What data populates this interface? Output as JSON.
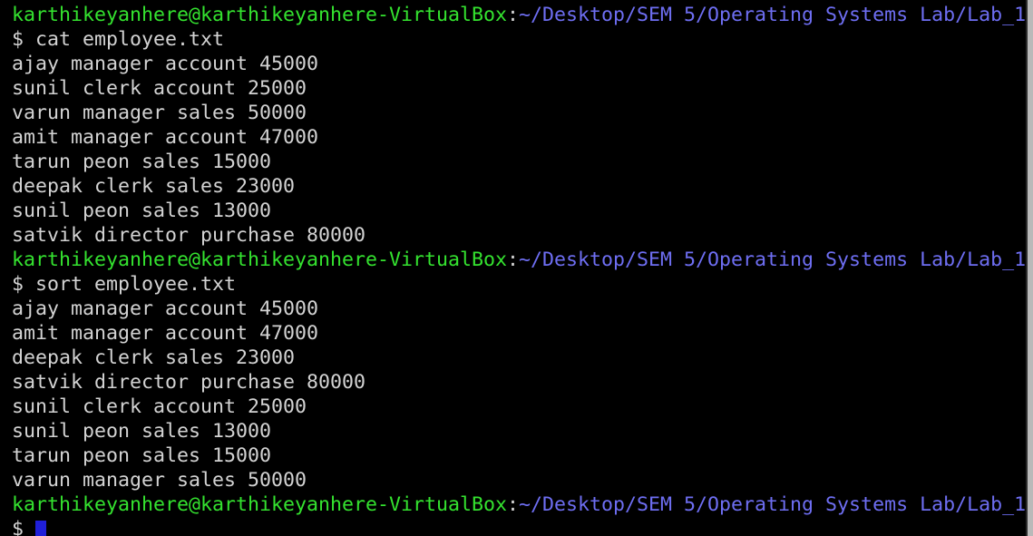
{
  "prompt": {
    "user_host": "karthikeyanhere@karthikeyanhere-VirtualBox",
    "separator": ":",
    "cwd": "~/Desktop/SEM 5/Operating Systems Lab/Lab_1"
  },
  "commands": [
    {
      "input": "$ cat employee.txt",
      "output": [
        "ajay manager account 45000",
        "sunil clerk account 25000",
        "varun manager sales 50000",
        "amit manager account 47000",
        "tarun peon sales 15000",
        "deepak clerk sales 23000",
        "sunil peon sales 13000",
        "satvik director purchase 80000"
      ]
    },
    {
      "input": "$ sort employee.txt",
      "output": [
        "ajay manager account 45000",
        "amit manager account 47000",
        "deepak clerk sales 23000",
        "satvik director purchase 80000",
        "sunil clerk account 25000",
        "sunil peon sales 13000",
        "tarun peon sales 15000",
        "varun manager sales 50000"
      ]
    }
  ],
  "current_input": "$ ",
  "colors": {
    "background": "#000000",
    "text": "#d3d3d3",
    "user_host": "#34e22f",
    "path": "#6e6ef2",
    "cursor": "#1f1fd9"
  }
}
